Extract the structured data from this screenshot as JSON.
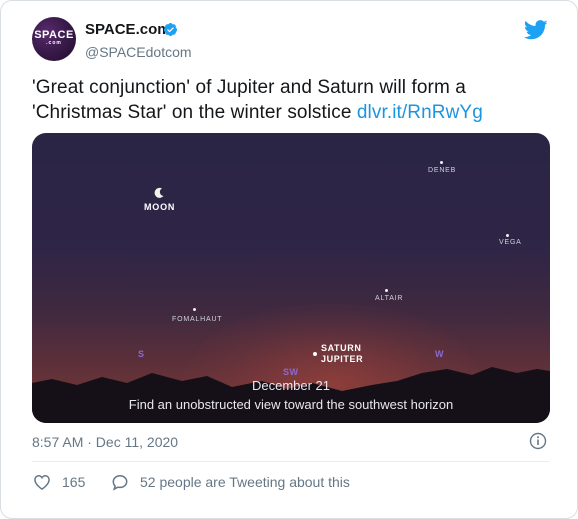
{
  "account": {
    "name": "SPACE.com",
    "handle": "@SPACEdotcom",
    "avatar_text": "SPACE",
    "avatar_subtext": ".com"
  },
  "tweet": {
    "text": "'Great conjunction' of Jupiter and Saturn will form a 'Christmas Star' on the winter solstice ",
    "link_text": "dlvr.it/RnRwYg",
    "timestamp": "8:57 AM · Dec 11, 2020"
  },
  "media": {
    "labels": {
      "moon": "MOON",
      "deneb": "DENEB",
      "vega": "VEGA",
      "altair": "ALTAIR",
      "fomalhaut": "FOMALHAUT",
      "saturn": "SATURN",
      "jupiter": "JUPITER",
      "dir_s": "S",
      "dir_sw": "SW",
      "dir_w": "W"
    },
    "caption_date": "December 21",
    "caption_text": "Find an unobstructed view toward the southwest horizon"
  },
  "engagement": {
    "likes": "165",
    "conversation": "52 people are Tweeting about this"
  },
  "colors": {
    "link": "#1b95e0",
    "twitter_blue": "#1da1f2",
    "secondary_text": "#657786"
  },
  "icons": {
    "verified": "verified-badge-icon",
    "twitter": "twitter-bird-icon",
    "info": "info-icon",
    "like": "heart-icon",
    "reply": "speech-bubble-icon"
  }
}
